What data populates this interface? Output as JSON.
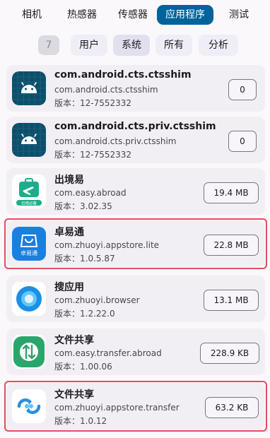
{
  "tabs": [
    "相机",
    "热感器",
    "传感器",
    "应用程序",
    "测试"
  ],
  "filters": {
    "count": "7",
    "items": [
      "用户",
      "系统",
      "所有",
      "分析"
    ],
    "selected": "系统"
  },
  "version_prefix": "版本：",
  "apps": [
    {
      "name": "com.android.cts.ctsshim",
      "package": "com.android.cts.ctsshim",
      "version": "版本：12-7552332",
      "size": "0",
      "icon": "android-icon"
    },
    {
      "name": "com.android.cts.priv.ctsshim",
      "package": "com.android.cts.priv.ctsshim",
      "version": "版本：12-7552332",
      "size": "0",
      "icon": "android-icon"
    },
    {
      "name": "出境易",
      "package": "com.easy.abroad",
      "version": "版本：3.02.35",
      "size": "19.4 MB",
      "icon": "suitcase-plane-icon",
      "icon_caption": "出境必备"
    },
    {
      "name": "卓易通",
      "package": "com.zhuoyi.appstore.lite",
      "version": "版本：1.0.5.87",
      "size": "22.8 MB",
      "icon": "shopping-bag-icon",
      "icon_caption": "卓易通"
    },
    {
      "name": "搜应用",
      "package": "com.zhuoyi.browser",
      "version": "版本：1.2.22.0",
      "size": "13.1 MB",
      "icon": "blue-circle-icon"
    },
    {
      "name": "文件共享",
      "package": "com.easy.transfer.abroad",
      "version": "版本：1.00.06",
      "size": "228.9 KB",
      "icon": "transfer-arrows-icon"
    },
    {
      "name": "文件共享",
      "package": "com.zhuoyi.appstore.transfer",
      "version": "版本：1.0.12",
      "size": "63.2 KB",
      "icon": "sync-icon"
    }
  ],
  "colors": {
    "accent": "#00639a",
    "highlight": "#e84c5d",
    "android_tile": "#0d4f6b"
  }
}
